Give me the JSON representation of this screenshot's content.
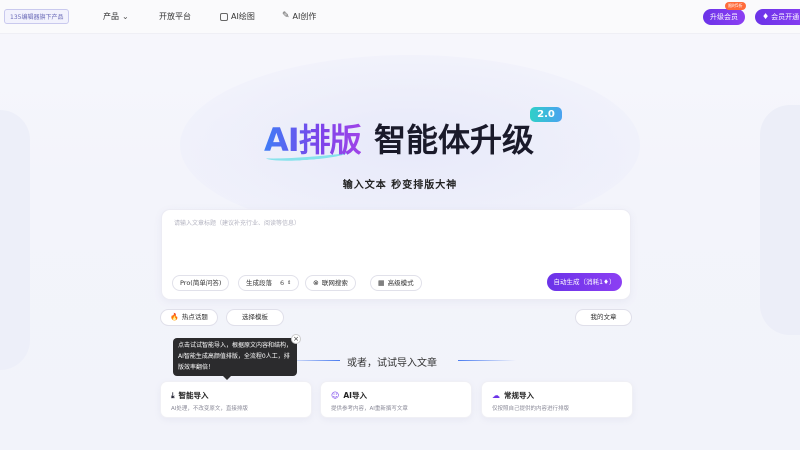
{
  "nav": {
    "logo": "135编辑器旗下产品",
    "items": [
      {
        "label": "产品",
        "has_chevron": true
      },
      {
        "label": "开放平台"
      },
      {
        "label": "AI绘图",
        "icon": "image-icon"
      },
      {
        "label": "AI创作",
        "icon": "pen-icon"
      }
    ],
    "upgrade_label": "升级会员",
    "upgrade_badge": "限时5折",
    "vip_label": "会员开通"
  },
  "hero": {
    "ai_text": "AI排版",
    "main_text": "智能体升级",
    "version": "2.0",
    "subtitle": "输入文本 秒变排版大神"
  },
  "input": {
    "placeholder": "请输入文章标题（建议补充行业、阅读等信息）",
    "mode_label": "Pro(简单问答)",
    "paragraphs_label": "生成段落",
    "paragraphs_value": "6",
    "web_search_label": "联网搜索",
    "advanced_label": "高级模式",
    "generate_label": "自动生成（消耗1♦）"
  },
  "chips": {
    "hot_topics": "热点话题",
    "choose_template": "选择模板",
    "my_articles": "我的文章"
  },
  "tooltip": {
    "text": "点击试试智能导入，根据原文内容和结构，AI智能生成高颜值排版，全流程0人工，排版效率翻倍！",
    "close": "×"
  },
  "divider": {
    "text": "或者，试试导入文章"
  },
  "import_cards": [
    {
      "title": "智能导入",
      "desc": "AI处理，不改变原文，直接排版",
      "icon": "smart-import-icon",
      "icon_color": "#1a1a2a"
    },
    {
      "title": "AI导入",
      "desc": "提供参考内容，AI重新撰写文章",
      "icon": "robot-icon",
      "icon_color": "#6b33e8"
    },
    {
      "title": "常规导入",
      "desc": "仅按照自己提供的内容进行排版",
      "icon": "cloud-upload-icon",
      "icon_color": "#6b33e8"
    }
  ],
  "colors": {
    "brand": "#7a3cf0",
    "accent_gradient_start": "#3f7df6",
    "accent_gradient_end": "#a043e8"
  }
}
